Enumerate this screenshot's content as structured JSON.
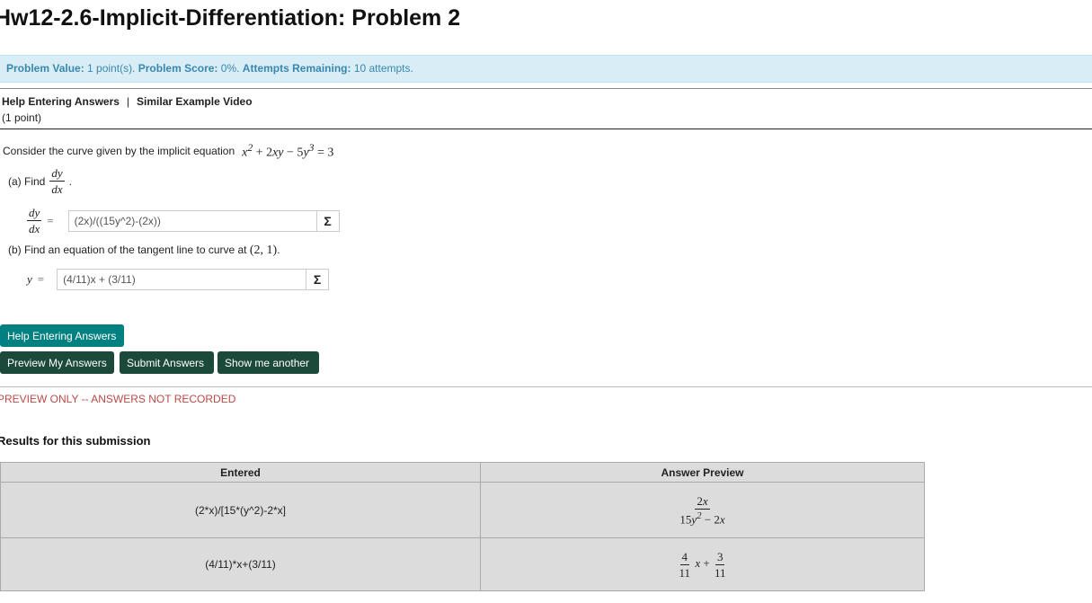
{
  "page": {
    "title": "Hw12-2.6-Implicit-Differentiation: Problem 2"
  },
  "info": {
    "value_label": "Problem Value:",
    "value_text": " 1 point(s). ",
    "score_label": "Problem Score:",
    "score_text": " 0%. ",
    "attempts_label": "Attempts Remaining:",
    "attempts_text": " 10 attempts."
  },
  "links": {
    "help": "Help Entering Answers",
    "separator": "|",
    "video": "Similar Example Video",
    "points": "(1 point)"
  },
  "problem": {
    "intro": "Consider the curve given by the implicit equation",
    "part_a": "(a) Find",
    "part_b_text": "(b) Find an equation of the tangent line to curve at",
    "point": "(2, 1)",
    "period": "."
  },
  "answers": {
    "a_value": "(2x)/((15y^2)-(2x))",
    "b_value": "(4/11)x + (3/11)",
    "sigma": "Σ"
  },
  "buttons": {
    "help": "Help Entering Answers",
    "preview": "Preview My Answers",
    "submit": "Submit Answers",
    "show": "Show me another"
  },
  "status": {
    "preview_note": "PREVIEW ONLY -- ANSWERS NOT RECORDED"
  },
  "results": {
    "title": "Results for this submission",
    "headers": [
      "Entered",
      "Answer Preview"
    ],
    "rows": [
      {
        "entered": "(2*x)/[15*(y^2)-2*x]"
      },
      {
        "entered": "(4/11)*x+(3/11)"
      }
    ]
  }
}
